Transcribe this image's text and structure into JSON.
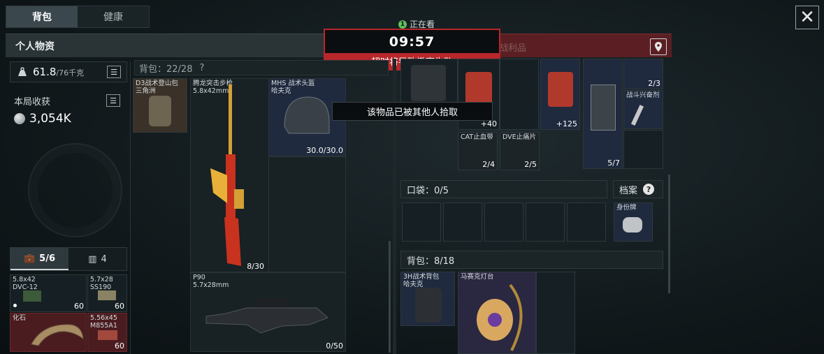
{
  "tabs": [
    {
      "label": "背包"
    },
    {
      "label": "健康"
    }
  ],
  "header": {
    "title": "个人物资",
    "right_title": "战利品"
  },
  "watching": {
    "count": "1",
    "label": "正在看"
  },
  "timer": {
    "value": "09:57",
    "warning": "超时将导致撤离失败"
  },
  "weight": {
    "value": "61.8",
    "max": "/76千克"
  },
  "income": {
    "label": "本局收获",
    "value": "3,054K"
  },
  "backpack_capacity": "背包：22/28",
  "pocket_tabs": [
    {
      "label": "5/6"
    },
    {
      "label": "4"
    }
  ],
  "tooltip": "该物品已被其他人拾取",
  "left_items": [
    {
      "name": "5.8x42\nDVC-12",
      "qty": "60"
    },
    {
      "name": "5.7x28\nSS190",
      "qty": "60"
    },
    {
      "name": "化石",
      "qty": ""
    },
    {
      "name": "5.56x45\nM855A1",
      "qty": "60"
    }
  ],
  "equip": {
    "bag": {
      "name": "D3战术登山包\n三角洲"
    },
    "rifle": {
      "name": "腾龙突击步枪\n5.8x42mm",
      "ammo": "8/30"
    },
    "helmet": {
      "name": "MHS 战术头盔\n哈夫克",
      "durability": "30.0/30.0"
    },
    "smg": {
      "name": "P90\n5.7x28mm",
      "ammo": "0/50"
    }
  },
  "loot_items": [
    {
      "name": "",
      "qty": "+40"
    },
    {
      "name": "",
      "qty": "+125"
    },
    {
      "name": "",
      "qty": "2/3"
    },
    {
      "name": "战斗兴奋剂",
      "qty": ""
    },
    {
      "name": "CAT止血带",
      "qty": "2/4"
    },
    {
      "name": "DVE止痛片",
      "qty": "2/5"
    },
    {
      "name": "",
      "qty": "5/7"
    }
  ],
  "pocket_section": {
    "label": "口袋：0/5"
  },
  "archive_section": {
    "label": "档案",
    "item": "身份牌"
  },
  "loot_backpack": {
    "label": "背包：8/18",
    "bag_name": "3H战术背包\n哈夫克",
    "lamp_name": "马赛克灯台"
  },
  "colors": {
    "accent_red": "#b8272b",
    "panel": "#1a2326",
    "loot_red": "#4a1c1f"
  }
}
